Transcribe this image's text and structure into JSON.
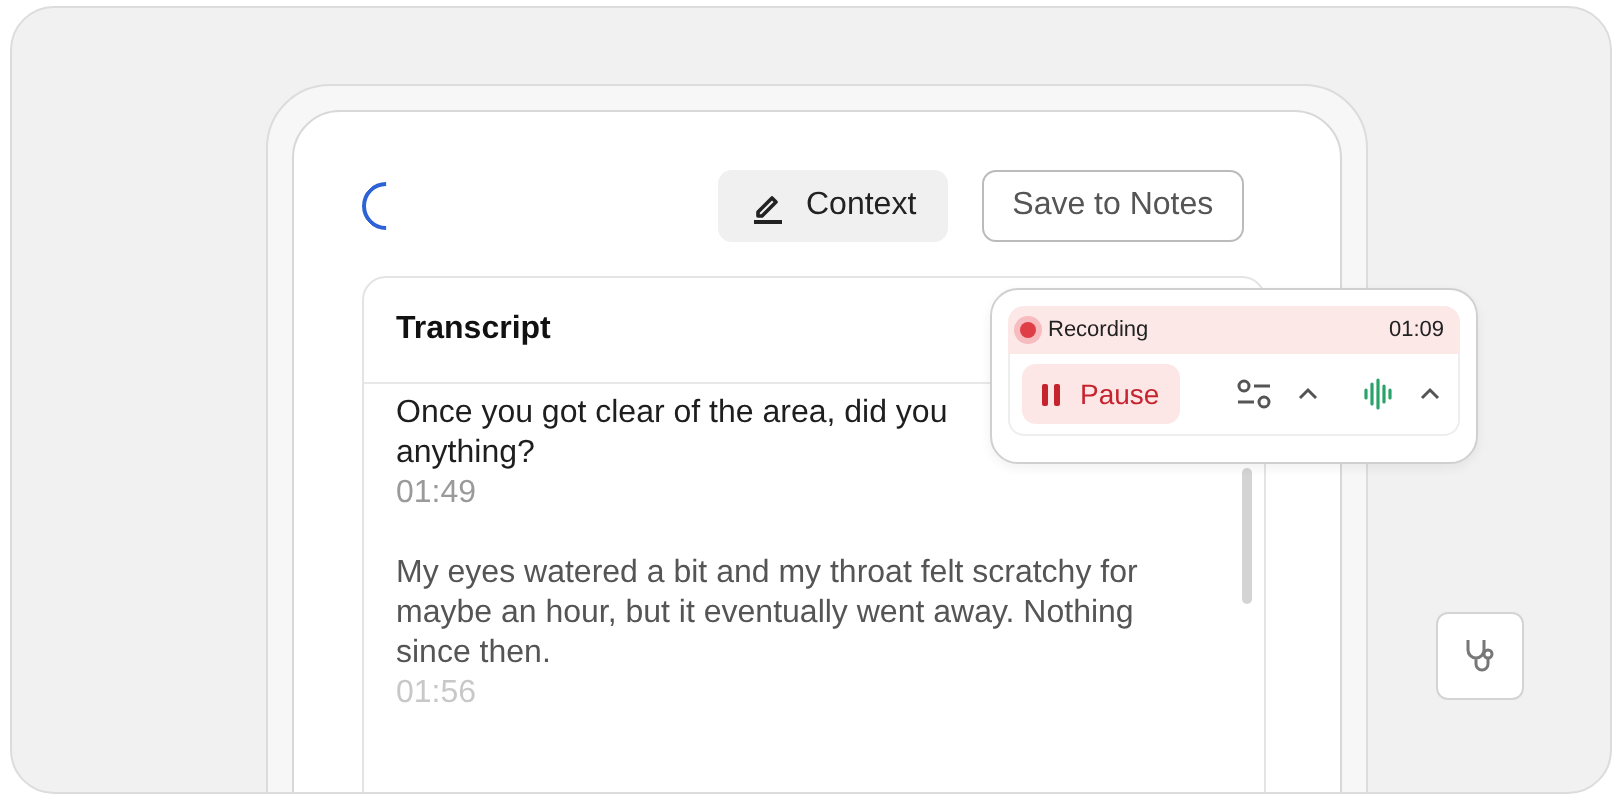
{
  "toolbar": {
    "context_button": "Context",
    "save_button": "Save to Notes"
  },
  "transcript": {
    "title": "Transcript",
    "messages": [
      {
        "lines": [
          "Once you got clear of the area, did you",
          "anything?"
        ],
        "time": "01:49",
        "kind": "question"
      },
      {
        "lines": [
          "My eyes watered a bit and my throat felt scratchy for",
          "maybe an hour, but it eventually went away. Nothing",
          "since then."
        ],
        "time": "01:56",
        "kind": "answer"
      }
    ]
  },
  "recorder": {
    "status": "Recording",
    "elapsed": "01:09",
    "pause_button": "Pause"
  }
}
